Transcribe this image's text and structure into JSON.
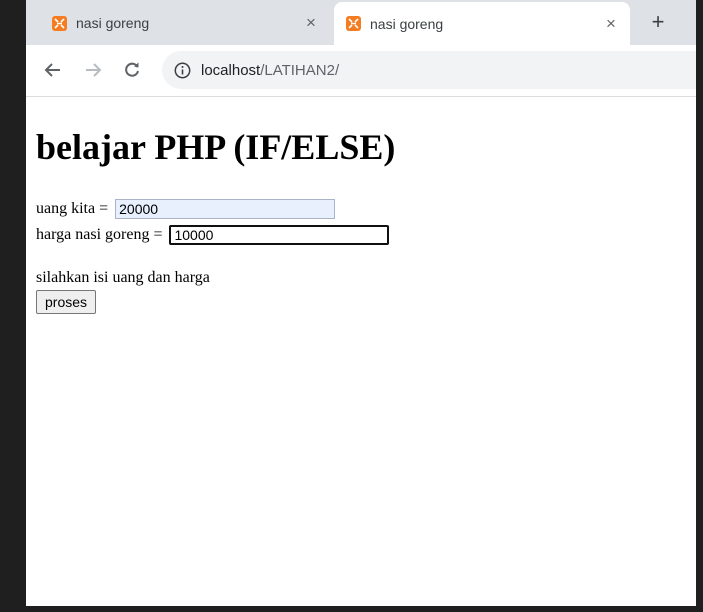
{
  "browser": {
    "tabs": [
      {
        "title": "nasi goreng",
        "active": false
      },
      {
        "title": "nasi goreng",
        "active": true
      }
    ],
    "tab_close_glyph": "×",
    "new_tab_glyph": "+",
    "url_host": "localhost",
    "url_path": "/LATIHAN2/",
    "favicon_color": "#f57c20"
  },
  "page": {
    "heading": "belajar PHP (IF/ELSE)",
    "uang_label": "uang kita = ",
    "uang_value": "20000",
    "harga_label": "harga nasi goreng = ",
    "harga_value": "10000",
    "message": "silahkan isi uang dan harga",
    "submit_label": "proses"
  }
}
